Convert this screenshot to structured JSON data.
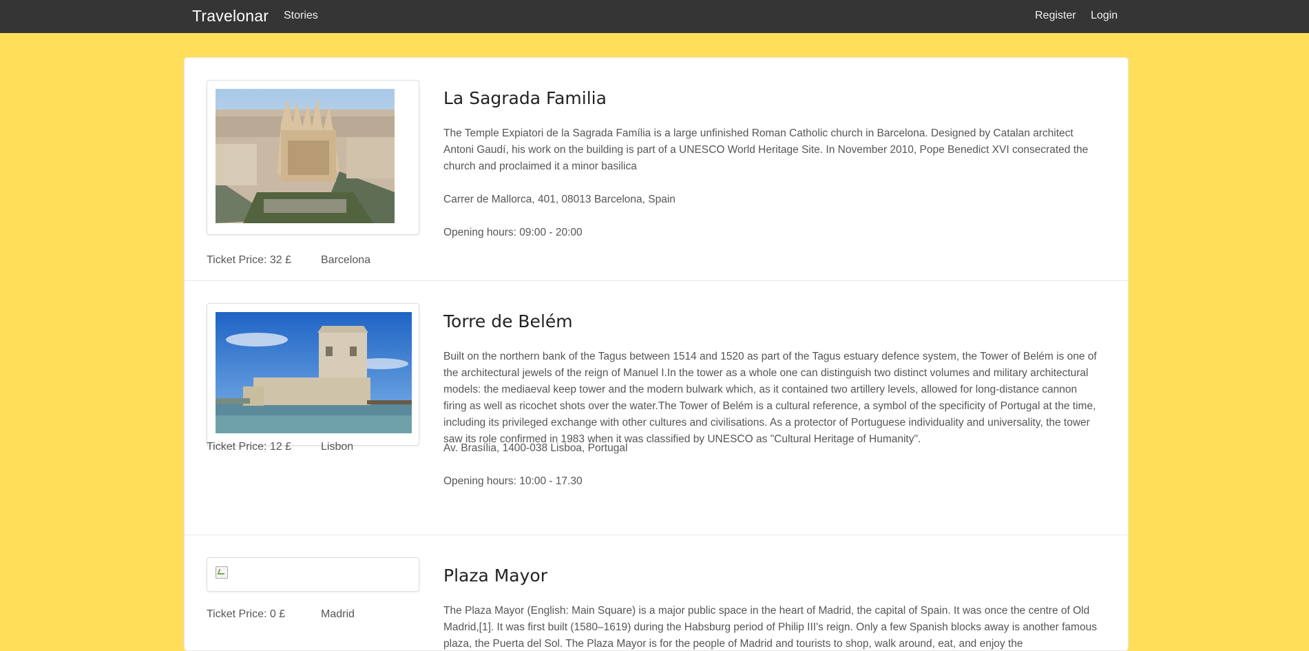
{
  "nav": {
    "brand": "Travelonar",
    "stories": "Stories",
    "register": "Register",
    "login": "Login"
  },
  "items": [
    {
      "title": "La Sagrada Familia",
      "description": "The Temple Expiatori de la Sagrada Família is a large unfinished Roman Catholic church in Barcelona. Designed by Catalan architect Antoni Gaudí, his work on the building is part of a UNESCO World Heritage Site. In November 2010, Pope Benedict XVI consecrated the church and proclaimed it a minor basilica",
      "address": "Carrer de Mallorca, 401, 08013 Barcelona, Spain",
      "hours": "Opening hours: 09:00 - 20:00",
      "price": "Ticket Price: 32 £",
      "city": "Barcelona"
    },
    {
      "title": "Torre de Belém",
      "description": "Built on the northern bank of the Tagus between 1514 and 1520 as part of the Tagus estuary defence system, the Tower of Belém is one of the architectural jewels of the reign of Manuel I.In the tower as a whole one can distinguish two distinct volumes and military architectural models: the mediaeval keep tower and the modern bulwark which, as it contained two artillery levels, allowed for long-distance cannon firing as well as ricochet shots over the water.The Tower of Belém is a cultural reference, a symbol of the specificity of Portugal at the time, including its privileged exchange with other cultures and civilisations. As a protector of Portuguese individuality and universality, the tower saw its role confirmed in 1983 when it was classified by UNESCO as \"Cultural Heritage of Humanity\".",
      "address": "Av. Brasília, 1400-038 Lisboa, Portugal",
      "hours": "Opening hours: 10:00 - 17.30",
      "price": "Ticket Price: 12 £",
      "city": "Lisbon"
    },
    {
      "title": "Plaza Mayor",
      "description": "The Plaza Mayor (English: Main Square) is a major public space in the heart of Madrid, the capital of Spain. It was once the centre of Old Madrid,[1]. It was first built (1580–1619) during the Habsburg period of Philip III's reign. Only a few Spanish blocks away is another famous plaza, the Puerta del Sol. The Plaza Mayor is for the people of Madrid and tourists to shop, walk around, eat, and enjoy the",
      "price": "Ticket Price: 0 £",
      "city": "Madrid"
    }
  ]
}
